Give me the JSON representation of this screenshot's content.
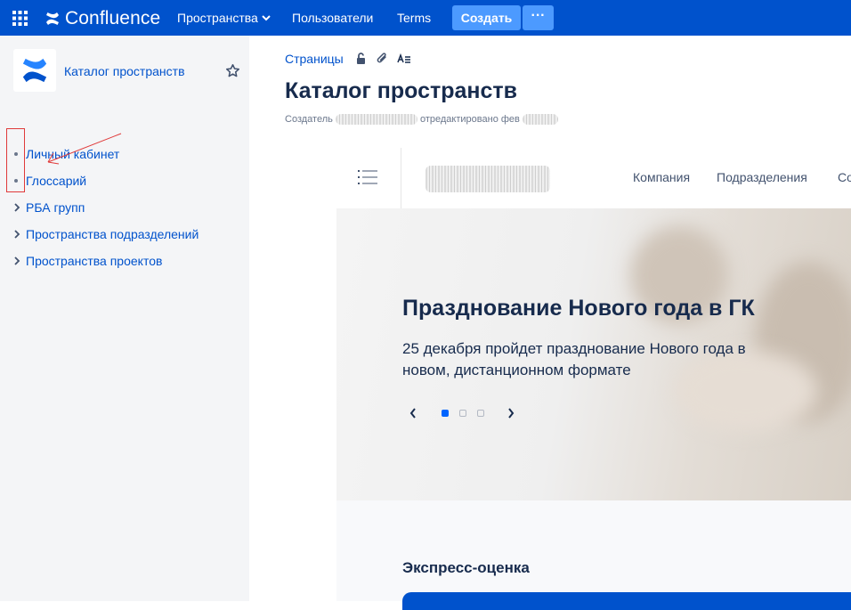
{
  "topbar": {
    "app_name": "Confluence",
    "nav_spaces": "Пространства",
    "nav_users": "Пользователи",
    "nav_terms": "Terms",
    "create_label": "Создать",
    "more_label": "···",
    "colors": {
      "bar": "#0052cc",
      "create_button": "#4c9aff"
    }
  },
  "sidebar": {
    "space_name": "Каталог пространств",
    "items": [
      {
        "label": "Личный кабинет",
        "marker": "bullet"
      },
      {
        "label": "Глоссарий",
        "marker": "bullet"
      },
      {
        "label": "РБА групп",
        "marker": "chevron-right"
      },
      {
        "label": "Пространства подразделений",
        "marker": "chevron-right"
      },
      {
        "label": "Пространства проектов",
        "marker": "chevron-right"
      }
    ]
  },
  "page": {
    "breadcrumb": "Страницы",
    "title": "Каталог пространств",
    "byline_start": "Создатель",
    "byline_mid": "отредактировано",
    "byline_end": "фев"
  },
  "portal": {
    "nav": [
      "Компания",
      "Подразделения",
      "Со"
    ],
    "hero_title": "Празднование Нового года в ГК",
    "hero_text": "25 декабря пройдет празднование Нового года в новом, дистанционном формате",
    "carousel_active_index": 0,
    "carousel_count": 3,
    "section_title": "Экспресс-оценка",
    "accent_color": "#0065ff"
  }
}
